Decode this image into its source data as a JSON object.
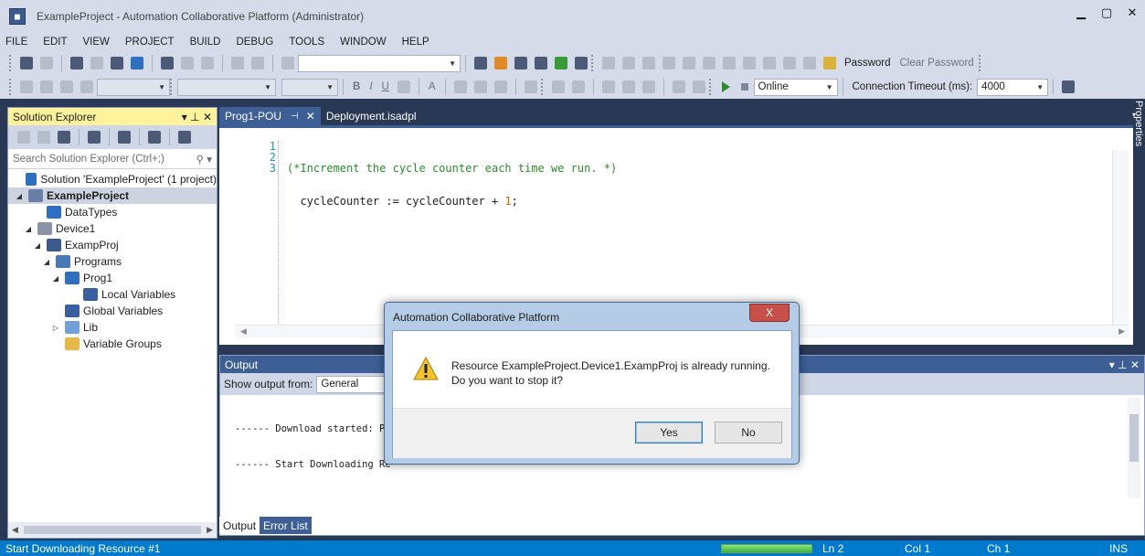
{
  "window": {
    "title": "ExampleProject - Automation Collaborative Platform (Administrator)",
    "icon": "app-icon",
    "controls": [
      "minimize-icon",
      "maximize-icon",
      "close-icon"
    ],
    "min_glyph": "▁",
    "max_glyph": "▢",
    "close_glyph": "✕"
  },
  "menu": [
    "FILE",
    "EDIT",
    "VIEW",
    "PROJECT",
    "BUILD",
    "DEBUG",
    "TOOLS",
    "WINDOW",
    "HELP"
  ],
  "toolbar1": {
    "search_value": "",
    "password_label": "Password",
    "clear_password_label": "Clear Password"
  },
  "toolbar2": {
    "online_mode": "Online",
    "timeout_label": "Connection Timeout (ms):",
    "timeout_value": "4000",
    "bold": "B",
    "italic": "I",
    "underline": "U",
    "fontcolor": "A"
  },
  "solution_explorer": {
    "title": "Solution Explorer",
    "pin": "▾ ⊥ ✕",
    "search_placeholder": "Search Solution Explorer (Ctrl+;)",
    "search_glyph": "⚲ ▾",
    "tree": [
      {
        "label": "Solution 'ExampleProject' (1 project)",
        "depth": 0,
        "twisty": "",
        "icon": "solution-icon",
        "color": "#2f6fbf",
        "selected": false
      },
      {
        "label": "ExampleProject",
        "depth": 0,
        "twisty": "◢",
        "icon": "project-icon",
        "color": "#6a7fa8",
        "selected": true
      },
      {
        "label": "DataTypes",
        "depth": 2,
        "twisty": "",
        "icon": "datatypes-icon",
        "color": "#2f6fbf",
        "selected": false
      },
      {
        "label": "Device1",
        "depth": 1,
        "twisty": "◢",
        "icon": "device-icon",
        "color": "#8a93a6",
        "selected": false
      },
      {
        "label": "ExampProj",
        "depth": 2,
        "twisty": "◢",
        "icon": "resource-icon",
        "color": "#3c5a8c",
        "selected": false
      },
      {
        "label": "Programs",
        "depth": 3,
        "twisty": "◢",
        "icon": "programs-icon",
        "color": "#4c78b8",
        "selected": false
      },
      {
        "label": "Prog1",
        "depth": 4,
        "twisty": "◢",
        "icon": "program-icon",
        "color": "#2f6fbf",
        "selected": false
      },
      {
        "label": "Local Variables",
        "depth": 6,
        "twisty": "",
        "icon": "variables-icon",
        "color": "#3a5fa0",
        "selected": false
      },
      {
        "label": "Global Variables",
        "depth": 4,
        "twisty": "",
        "icon": "variables-icon",
        "color": "#3a5fa0",
        "selected": false
      },
      {
        "label": "Lib",
        "depth": 4,
        "twisty": "▷",
        "icon": "library-icon",
        "color": "#6fa0d8",
        "selected": false
      },
      {
        "label": "Variable Groups",
        "depth": 4,
        "twisty": "",
        "icon": "folder-icon",
        "color": "#e8b84a",
        "selected": false
      }
    ],
    "scroll_left": "◀",
    "scroll_right": "▶"
  },
  "editor": {
    "tabs": [
      {
        "label": "Prog1-POU",
        "active": true
      },
      {
        "label": "Deployment.isadpl",
        "active": false
      }
    ],
    "pin_glyph": "⊣",
    "close_glyph": "✕",
    "dropdown_glyph": "▾",
    "line_numbers": [
      "1",
      "2",
      "3"
    ],
    "line1": "(*Increment the cycle counter each time we run. *)",
    "line2_a": "  cycleCounter := cycleCounter + ",
    "line2_num": "1",
    "line2_b": ";",
    "line3": "",
    "scroll_left": "◀",
    "scroll_right": "▶",
    "properties_label": "Properties"
  },
  "output": {
    "title": "Output",
    "controls": "▾ ⊥ ✕",
    "show_from_label": "Show output from:",
    "show_from_value": "General",
    "lines": [
      "------ Download started: Pr",
      "------ Start Downloading Re"
    ],
    "tabs": [
      {
        "label": "Output",
        "active": true
      },
      {
        "label": "Error List",
        "active": false
      }
    ]
  },
  "statusbar": {
    "text": "Start Downloading Resource #1",
    "progress": 1.0,
    "ln": "Ln 2",
    "col": "Col 1",
    "ch": "Ch 1",
    "mode": "INS"
  },
  "dialog": {
    "title": "Automation Collaborative Platform",
    "close_glyph": "X",
    "icon": "warning-icon",
    "message_line1": "Resource ExampleProject.Device1.ExampProj is already running.",
    "message_line2": "Do you want to stop it?",
    "yes_label": "Yes",
    "no_label": "No"
  },
  "colors": {
    "chrome": "#d6dbe9",
    "accent": "#3e5f96",
    "status": "#007acc",
    "highlight": "#fff29d",
    "comment": "#2e8b2e"
  }
}
